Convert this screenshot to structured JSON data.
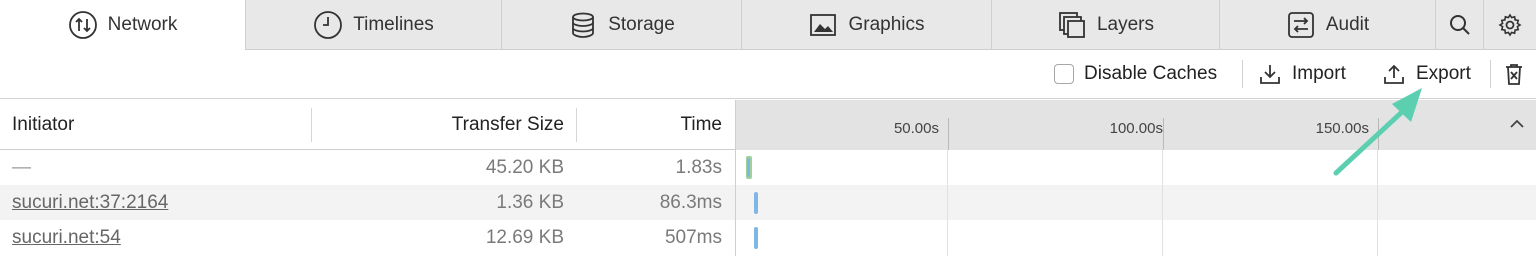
{
  "tabs": [
    {
      "label": "Network",
      "icon": "network-icon",
      "active": true
    },
    {
      "label": "Timelines",
      "icon": "timelines-icon"
    },
    {
      "label": "Storage",
      "icon": "storage-icon"
    },
    {
      "label": "Graphics",
      "icon": "graphics-icon"
    },
    {
      "label": "Layers",
      "icon": "layers-icon"
    },
    {
      "label": "Audit",
      "icon": "audit-icon"
    }
  ],
  "toolbar": {
    "disable_caches_label": "Disable Caches",
    "import_label": "Import",
    "export_label": "Export"
  },
  "table": {
    "headers": {
      "initiator": "Initiator",
      "transfer_size": "Transfer Size",
      "time": "Time"
    },
    "waterfall_ticks": [
      "50.00s",
      "100.00s",
      "150.00s"
    ],
    "rows": [
      {
        "initiator": "—",
        "transfer_size": "45.20 KB",
        "time": "1.83s"
      },
      {
        "initiator": "sucuri.net:37:2164",
        "transfer_size": "1.36 KB",
        "time": "86.3ms"
      },
      {
        "initiator": "sucuri.net:54",
        "transfer_size": "12.69 KB",
        "time": "507ms"
      }
    ]
  },
  "colors": {
    "annotation_arrow": "#5ccfb1",
    "bar_blue": "#7fb6e6",
    "bar_green": "#9fd39a"
  }
}
